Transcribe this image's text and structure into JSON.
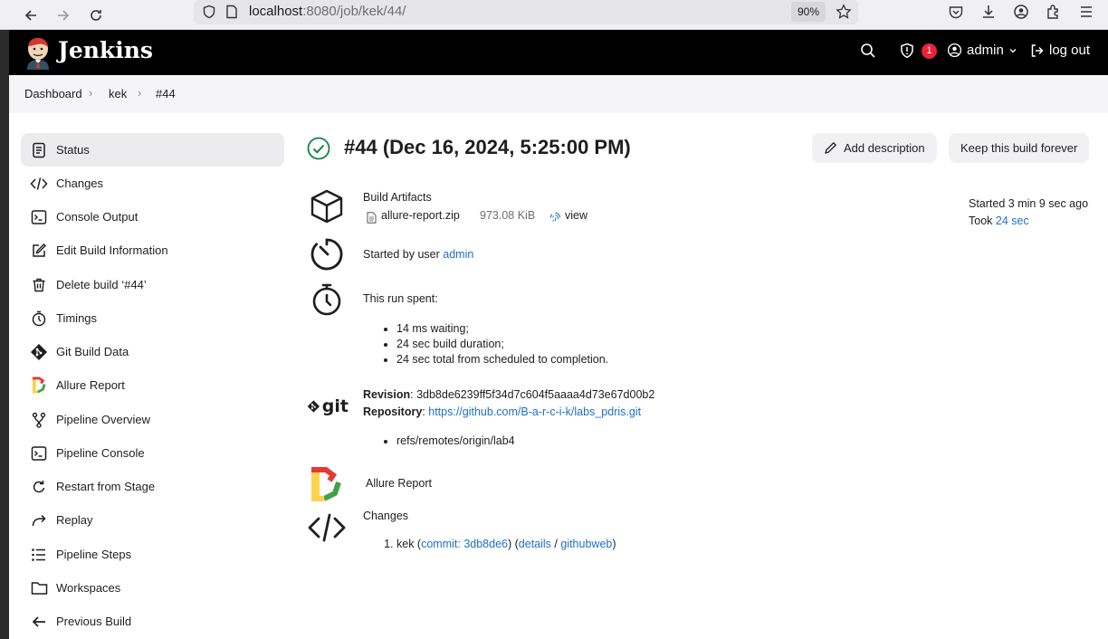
{
  "browser": {
    "url_host": "localhost",
    "url_rest": ":8080/job/kek/44/",
    "zoom": "90%"
  },
  "header": {
    "brand": "Jenkins",
    "alert_count": "1",
    "user": "admin",
    "logout": "log out"
  },
  "breadcrumb": [
    "Dashboard",
    "kek",
    "#44"
  ],
  "sidebar": {
    "items": [
      {
        "label": "Status",
        "icon": "status-icon"
      },
      {
        "label": "Changes",
        "icon": "code-icon"
      },
      {
        "label": "Console Output",
        "icon": "terminal-icon"
      },
      {
        "label": "Edit Build Information",
        "icon": "edit-icon"
      },
      {
        "label": "Delete build ‘#44’",
        "icon": "trash-icon"
      },
      {
        "label": "Timings",
        "icon": "stopwatch-icon"
      },
      {
        "label": "Git Build Data",
        "icon": "git-icon"
      },
      {
        "label": "Allure Report",
        "icon": "allure-icon"
      },
      {
        "label": "Pipeline Overview",
        "icon": "pipeline-icon"
      },
      {
        "label": "Pipeline Console",
        "icon": "terminal-icon"
      },
      {
        "label": "Restart from Stage",
        "icon": "restart-icon"
      },
      {
        "label": "Replay",
        "icon": "replay-icon"
      },
      {
        "label": "Pipeline Steps",
        "icon": "list-icon"
      },
      {
        "label": "Workspaces",
        "icon": "folder-icon"
      },
      {
        "label": "Previous Build",
        "icon": "arrow-left-icon"
      }
    ]
  },
  "build": {
    "title": "#44 (Dec 16, 2024, 5:25:00 PM)",
    "add_description": "Add description",
    "keep_forever": "Keep this build forever",
    "started_ago": "Started 3 min 9 sec ago",
    "took_label": "Took",
    "took_value": "24 sec"
  },
  "artifacts": {
    "heading": "Build Artifacts",
    "file": "allure-report.zip",
    "size": "973.08 KiB",
    "view": "view"
  },
  "cause": {
    "prefix": "Started by user",
    "user": "admin"
  },
  "timing": {
    "heading": "This run spent:",
    "items": [
      "14 ms waiting;",
      "24 sec build duration;",
      "24 sec total from scheduled to completion."
    ]
  },
  "git": {
    "revision_label": "Revision",
    "revision": "3db8de6239ff5f34d7c604f5aaaa4d73e67d00b2",
    "repo_label": "Repository",
    "repo": "https://github.com/B-a-r-c-i-k/labs_pdris.git",
    "refs": [
      "refs/remotes/origin/lab4"
    ]
  },
  "allure": {
    "link": "Allure Report"
  },
  "changes": {
    "heading": "Changes",
    "entry": {
      "author": "kek",
      "commit": "commit: 3db8de6",
      "details": "details",
      "web": "githubweb"
    }
  },
  "colors": {
    "success": "#138347",
    "link": "#1f6fc5",
    "alert": "#e8233a"
  }
}
